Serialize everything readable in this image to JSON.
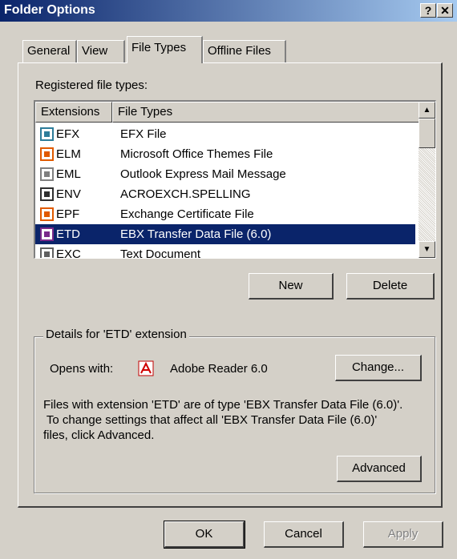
{
  "window": {
    "title": "Folder Options",
    "help_glyph": "?",
    "close_glyph": "✕"
  },
  "tabs": [
    {
      "label": "General"
    },
    {
      "label": "View"
    },
    {
      "label": "File Types"
    },
    {
      "label": "Offline Files"
    }
  ],
  "file_types": {
    "registered_label": "Registered file types:",
    "columns": [
      "Extensions",
      "File Types"
    ],
    "rows": [
      {
        "ext": "EFX",
        "type": "EFX File",
        "icon": "efx-file-icon",
        "color": "#2d7d9a"
      },
      {
        "ext": "ELM",
        "type": "Microsoft Office Themes File",
        "icon": "office-themes-icon",
        "color": "#e05a00"
      },
      {
        "ext": "EML",
        "type": "Outlook Express Mail Message",
        "icon": "mail-message-icon",
        "color": "#808080"
      },
      {
        "ext": "ENV",
        "type": "ACROEXCH.SPELLING",
        "icon": "spelling-icon",
        "color": "#303030"
      },
      {
        "ext": "EPF",
        "type": "Exchange Certificate File",
        "icon": "certificate-icon",
        "color": "#e05a00"
      },
      {
        "ext": "ETD",
        "type": "EBX Transfer Data File (6.0)",
        "icon": "ebx-file-icon",
        "color": "#7a2a8a",
        "selected": true
      },
      {
        "ext": "EXC",
        "type": "Text Document",
        "icon": "text-document-icon",
        "color": "#606060"
      }
    ]
  },
  "buttons": {
    "new": "New",
    "delete": "Delete",
    "change": "Change...",
    "advanced": "Advanced",
    "ok": "OK",
    "cancel": "Cancel",
    "apply": "Apply"
  },
  "details": {
    "group_title": "Details for 'ETD' extension",
    "opens_with_label": "Opens with:",
    "opens_with_app": "Adobe Reader 6.0",
    "app_icon": "adobe-reader-icon",
    "description_line1": "Files with extension 'ETD' are of type 'EBX Transfer Data File (6.0)'.",
    "description_line2": " To change settings that affect all 'EBX Transfer Data File (6.0)'",
    "description_line3": "files, click Advanced."
  },
  "colors": {
    "selection": "#0a246a",
    "face": "#d4d0c8",
    "title_start": "#0a246a",
    "title_end": "#a6caf0"
  }
}
